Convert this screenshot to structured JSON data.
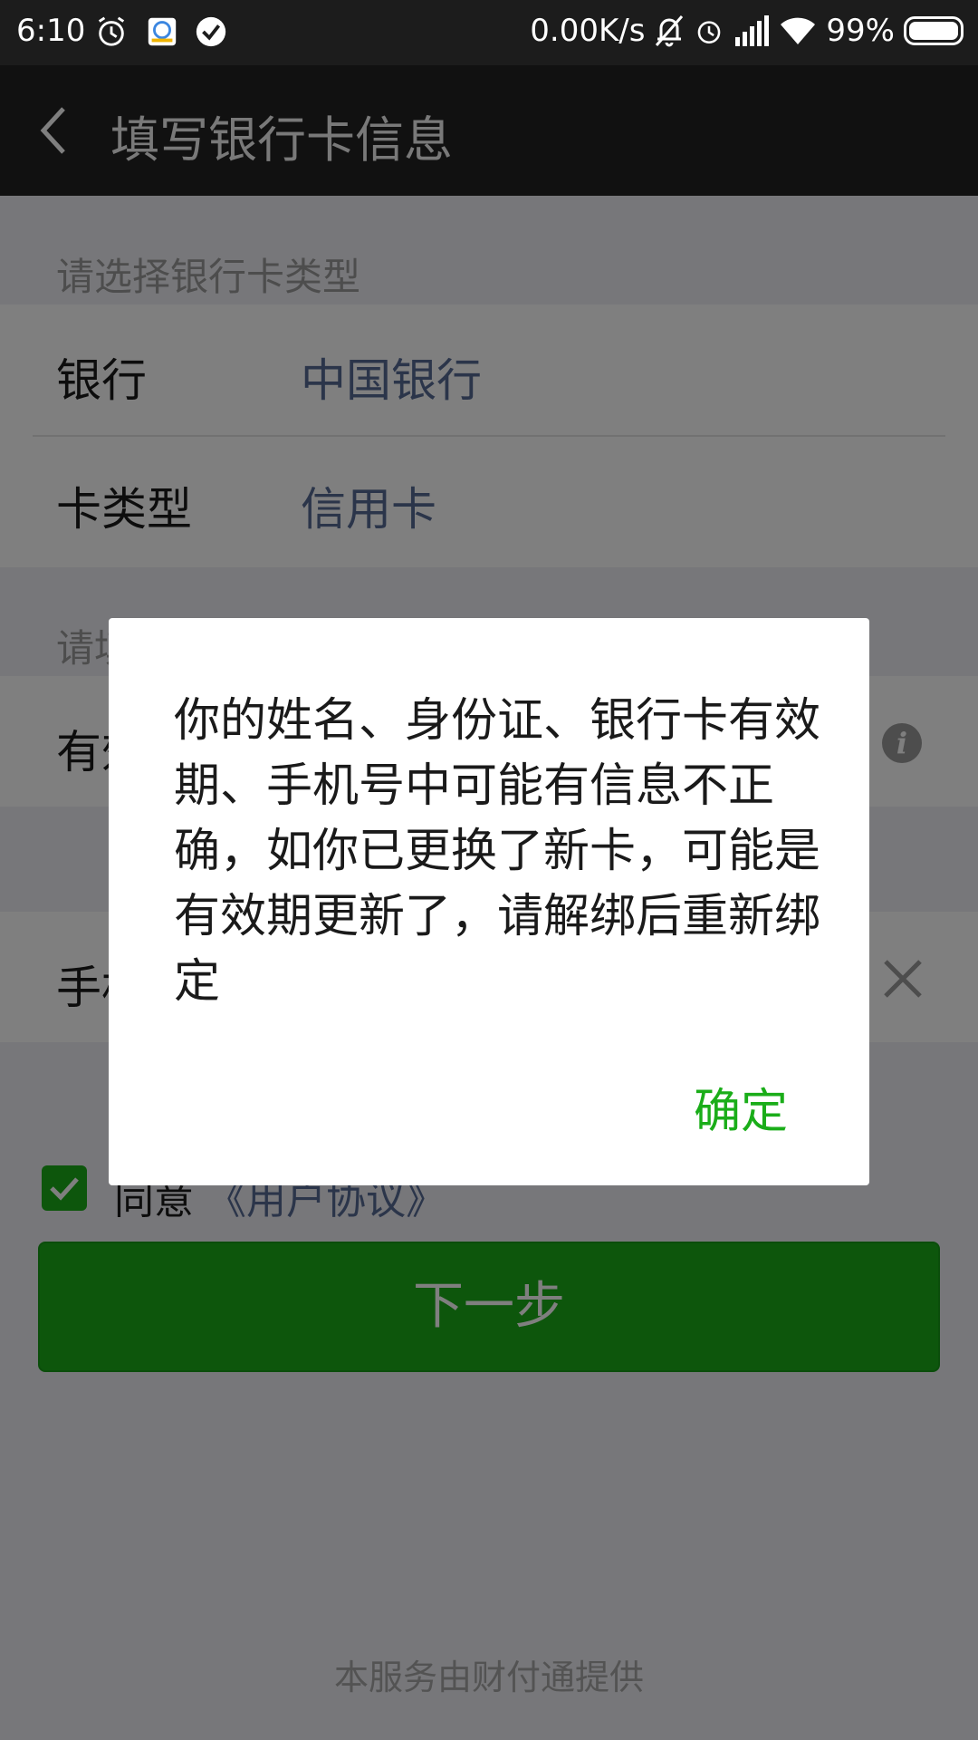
{
  "status_bar": {
    "time": "6:10",
    "net_speed": "0.00K/s",
    "battery": "99%"
  },
  "header": {
    "title": "填写银行卡信息"
  },
  "form": {
    "section1_hint": "请选择银行卡类型",
    "bank_label": "银行",
    "bank_value": "中国银行",
    "card_type_label": "卡类型",
    "card_type_value": "信用卡",
    "section2_hint_partial": "请填",
    "expiry_label_partial": "有效",
    "phone_label_partial": "手机"
  },
  "agreement": {
    "prefix": "同意",
    "link": "《用户协议》"
  },
  "next_button_label": "下一步",
  "footer": "本服务由财付通提供",
  "dialog": {
    "message": "你的姓名、身份证、银行卡有效期、手机号中可能有信息不正确，如你已更换了新卡，可能是有效期更新了，请解绑后重新绑定",
    "ok_label": "确定"
  },
  "colors": {
    "accent_green": "#1aad19",
    "link_blue": "#576b95"
  }
}
